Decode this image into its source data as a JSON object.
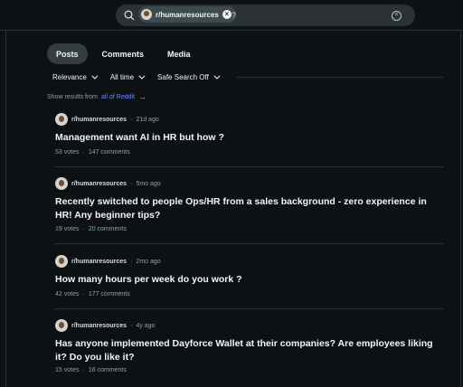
{
  "search": {
    "chip_label": "r/humanresources",
    "query": "?"
  },
  "tabs": [
    {
      "label": "Posts",
      "active": true
    },
    {
      "label": "Comments",
      "active": false
    },
    {
      "label": "Media",
      "active": false
    }
  ],
  "filters": {
    "sort": "Relevance",
    "time": "All time",
    "safe": "Safe Search Off"
  },
  "show_results": {
    "prefix": "Show results from",
    "link": "all of Reddit"
  },
  "posts": [
    {
      "subreddit": "r/humanresources",
      "time": "21d ago",
      "title": "Management want AI in HR but how ?",
      "votes": "53 votes",
      "comments": "147 comments"
    },
    {
      "subreddit": "r/humanresources",
      "time": "5mo ago",
      "title": "Recently switched to people Ops/HR from a sales background - zero experience in HR! Any beginner tips?",
      "votes": "19 votes",
      "comments": "20 comments"
    },
    {
      "subreddit": "r/humanresources",
      "time": "2mo ago",
      "title": "How many hours per week do you work ?",
      "votes": "42 votes",
      "comments": "177 comments"
    },
    {
      "subreddit": "r/humanresources",
      "time": "4y ago",
      "title": "Has anyone implemented Dayforce Wallet at their companies? Are employees liking it? Do you like it?",
      "votes": "15 votes",
      "comments": "16 comments"
    }
  ],
  "separator": "·"
}
